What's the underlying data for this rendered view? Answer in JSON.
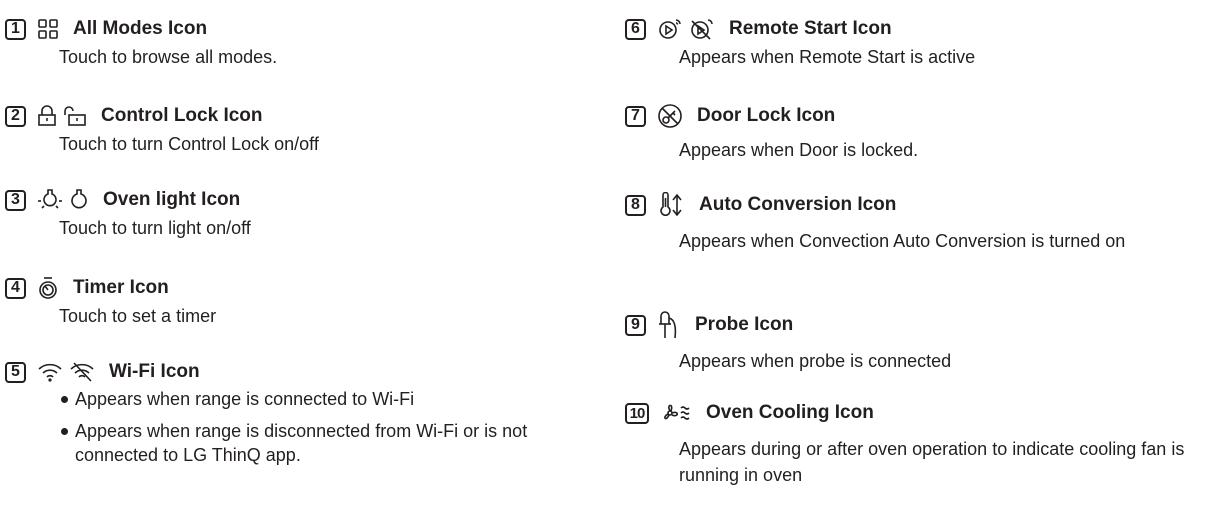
{
  "left": [
    {
      "number": "1",
      "icons": [
        "all-modes-icon"
      ],
      "title": "All Modes Icon",
      "description": "Touch to browse all modes."
    },
    {
      "number": "2",
      "icons": [
        "lock-closed-icon",
        "lock-open-icon"
      ],
      "title": "Control Lock Icon",
      "description": "Touch to turn Control Lock on/off"
    },
    {
      "number": "3",
      "icons": [
        "light-on-icon",
        "light-off-icon"
      ],
      "title": "Oven light Icon",
      "description": "Touch to turn light on/off"
    },
    {
      "number": "4",
      "icons": [
        "timer-icon"
      ],
      "title": "Timer Icon",
      "description": "Touch to set a timer"
    },
    {
      "number": "5",
      "icons": [
        "wifi-icon",
        "wifi-off-icon"
      ],
      "title": "Wi-Fi Icon",
      "bullets": [
        "Appears when range is connected to Wi-Fi",
        "Appears when range is disconnected from Wi-Fi or is not connected to LG ThinQ app."
      ]
    }
  ],
  "right": [
    {
      "number": "6",
      "icons": [
        "remote-start-icon",
        "remote-start-off-icon"
      ],
      "title": "Remote Start Icon",
      "description": "Appears when Remote Start is active"
    },
    {
      "number": "7",
      "icons": [
        "door-lock-icon"
      ],
      "title": "Door Lock Icon",
      "description": "Appears when Door is locked."
    },
    {
      "number": "8",
      "icons": [
        "thermometer-arrows-icon"
      ],
      "title": "Auto Conversion Icon",
      "description": "Appears when Convection Auto Conversion is turned on"
    },
    {
      "number": "9",
      "icons": [
        "probe-icon"
      ],
      "title": "Probe Icon",
      "description": "Appears when probe is connected"
    },
    {
      "number": "10",
      "icons": [
        "fan-heat-icon"
      ],
      "title": "Oven Cooling Icon",
      "description": "Appears during or after oven operation to indicate cooling fan is running in oven"
    }
  ]
}
